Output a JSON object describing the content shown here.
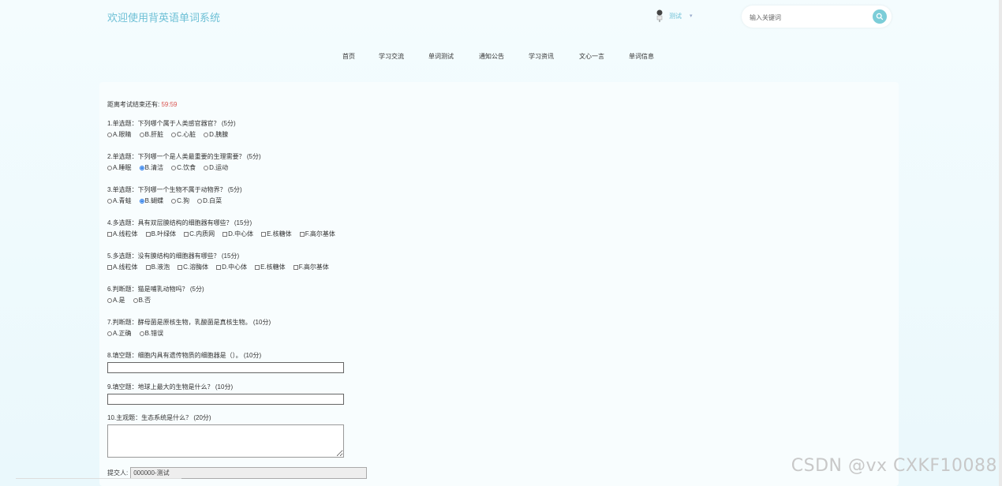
{
  "header": {
    "title": "欢迎使用背英语单词系统",
    "user_name": "测试",
    "user_caret": "▾",
    "search_placeholder": "输入关键词"
  },
  "nav": {
    "items": [
      "首页",
      "学习交流",
      "单词测试",
      "通知公告",
      "学习资讯",
      "文心一言",
      "单词信息"
    ]
  },
  "exam": {
    "countdown_label": "距离考试结束还有:",
    "countdown_time": "59:59",
    "questions": [
      {
        "title": "1.单选题：下列哪个属于人类感官器官？ (5分)",
        "options": [
          "A.眼睛",
          "B.肝脏",
          "C.心脏",
          "D.胰腺"
        ]
      },
      {
        "title": "2.单选题：下列哪一个是人类最重要的生理需要？ (5分)",
        "options": [
          "A.睡眠",
          "B.清洁",
          "C.饮食",
          "D.运动"
        ],
        "selected": 1
      },
      {
        "title": "3.单选题：下列哪一个生物不属于动物界？ (5分)",
        "options": [
          "A.青蛙",
          "B.蝴蝶",
          "C.狗",
          "D.白菜"
        ],
        "selected": 1
      },
      {
        "title": "4.多选题：具有双层膜结构的细胞器有哪些？ (15分)",
        "options": [
          "A.线粒体",
          "B.叶绿体",
          "C.内质网",
          "D.中心体",
          "E.核糖体",
          "F.高尔基体"
        ]
      },
      {
        "title": "5.多选题：没有膜结构的细胞器有哪些？ (15分)",
        "options": [
          "A.线粒体",
          "B.液泡",
          "C.溶酶体",
          "D.中心体",
          "E.核糖体",
          "F.高尔基体"
        ]
      },
      {
        "title": "6.判断题：猫是哺乳动物吗？ (5分)",
        "options": [
          "A.是",
          "B.否"
        ]
      },
      {
        "title": "7.判断题：酵母菌是原核生物，乳酸菌是真核生物。 (10分)",
        "options": [
          "A.正确",
          "B.错误"
        ]
      },
      {
        "title": "8.填空题：细胞内具有遗传物质的细胞器是（）。 (10分)"
      },
      {
        "title": "9.填空题：地球上最大的生物是什么？ (10分)"
      },
      {
        "title": "10.主观题：生态系统是什么？ (20分)"
      }
    ],
    "submitter_label": "提交人:",
    "submitter_value": "000000-测试"
  },
  "watermark": "CSDN @vx  CXKF10088",
  "colors": {
    "accent": "#6ec0d6",
    "countdown": "#d9534f",
    "search_button": "#7ccdd8"
  }
}
